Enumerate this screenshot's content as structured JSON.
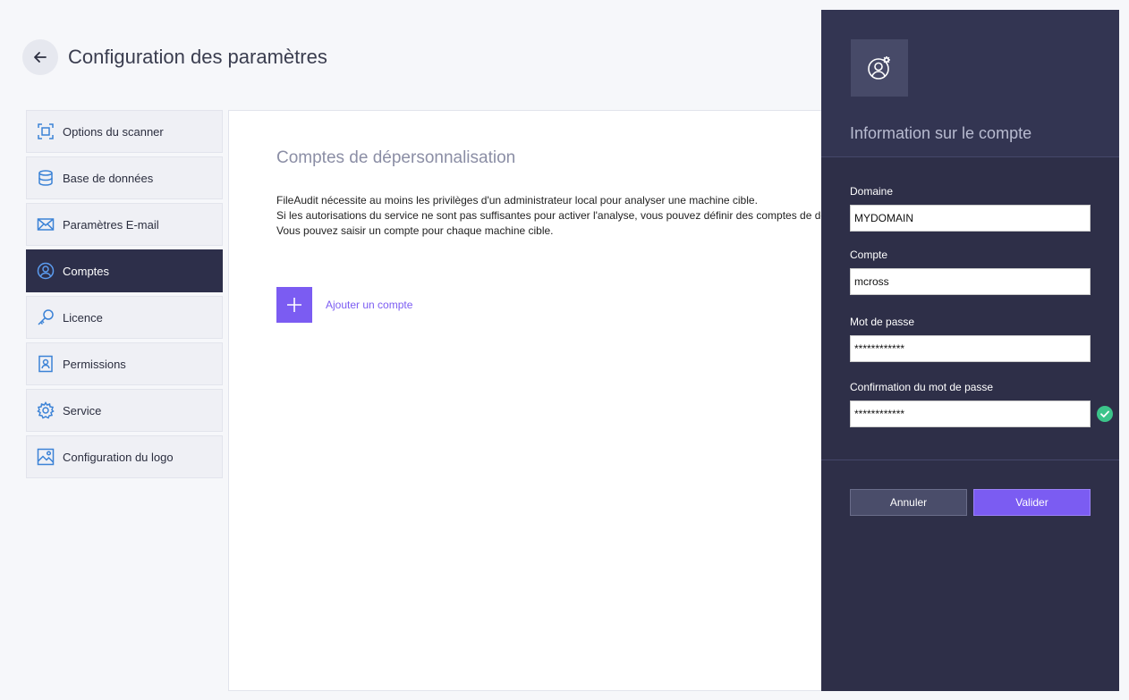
{
  "header": {
    "title": "Configuration des paramètres",
    "back_icon": "arrow-left-icon"
  },
  "sidebar": {
    "items": [
      {
        "label": "Options du scanner",
        "icon": "scanner-frame-icon",
        "active": false
      },
      {
        "label": "Base de données",
        "icon": "database-icon",
        "active": false
      },
      {
        "label": "Paramètres E-mail",
        "icon": "envelope-icon",
        "active": false
      },
      {
        "label": "Comptes",
        "icon": "user-circle-icon",
        "active": true
      },
      {
        "label": "Licence",
        "icon": "key-icon",
        "active": false
      },
      {
        "label": "Permissions",
        "icon": "badge-icon",
        "active": false
      },
      {
        "label": "Service",
        "icon": "gear-icon",
        "active": false
      },
      {
        "label": "Configuration du logo",
        "icon": "image-icon",
        "active": false
      }
    ]
  },
  "main": {
    "section_title": "Comptes de dépersonnalisation",
    "desc_line1": "FileAudit nécessite au moins les privilèges d'un administrateur local pour analyser une machine cible.",
    "desc_line2": "Si les autorisations du service ne sont pas suffisantes pour activer l'analyse, vous pouvez définir des comptes de dépersonnalisation.",
    "desc_line3": "Vous pouvez saisir un compte pour chaque machine cible.",
    "add_label": "Ajouter un compte"
  },
  "panel": {
    "title": "Information sur le compte",
    "icon": "user-gear-icon",
    "domain_label": "Domaine",
    "domain_value": "MYDOMAIN",
    "account_label": "Compte",
    "account_value": "mcross",
    "password_label": "Mot de passe",
    "password_value": "************",
    "confirm_label": "Confirmation du mot de passe",
    "confirm_value": "************",
    "cancel_label": "Annuler",
    "submit_label": "Valider"
  },
  "colors": {
    "accent": "#7b5cf2",
    "panel_bg": "#2e2f48",
    "active_nav": "#2d2f4a",
    "icon_blue": "#3b82d6",
    "success": "#3cc48a"
  }
}
